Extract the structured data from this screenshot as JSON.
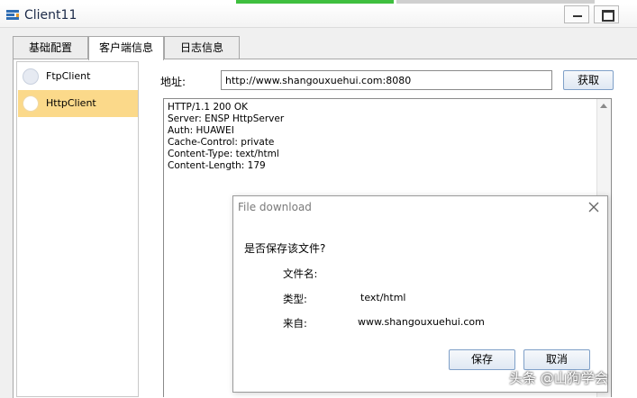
{
  "window": {
    "title": "Client11"
  },
  "tabs": [
    {
      "label": "基础配置"
    },
    {
      "label": "客户端信息"
    },
    {
      "label": "日志信息"
    }
  ],
  "clients": [
    {
      "label": "FtpClient",
      "selected": false
    },
    {
      "label": "HttpClient",
      "selected": true
    }
  ],
  "address": {
    "label": "地址:",
    "value": "http://www.shangouxuehui.com:8080"
  },
  "get_button": {
    "label": "获取"
  },
  "response": {
    "lines": [
      "HTTP/1.1 200 OK",
      "Server: ENSP HttpServer",
      "Auth: HUAWEI",
      "Cache-Control: private",
      "Content-Type: text/html",
      "Content-Length: 179"
    ]
  },
  "dialog": {
    "title": "File download",
    "question": "是否保存该文件?",
    "filename_label": "文件名:",
    "filename_value": "",
    "type_label": "类型:",
    "type_value": "text/html",
    "from_label": "来自:",
    "from_value": "www.shangouxuehui.com",
    "save_label": "保存",
    "cancel_label": "取消"
  },
  "watermark": "头条 @山狗学会",
  "colors": {
    "selected_item": "#fbd98a",
    "button_border": "#7fa0c8"
  }
}
